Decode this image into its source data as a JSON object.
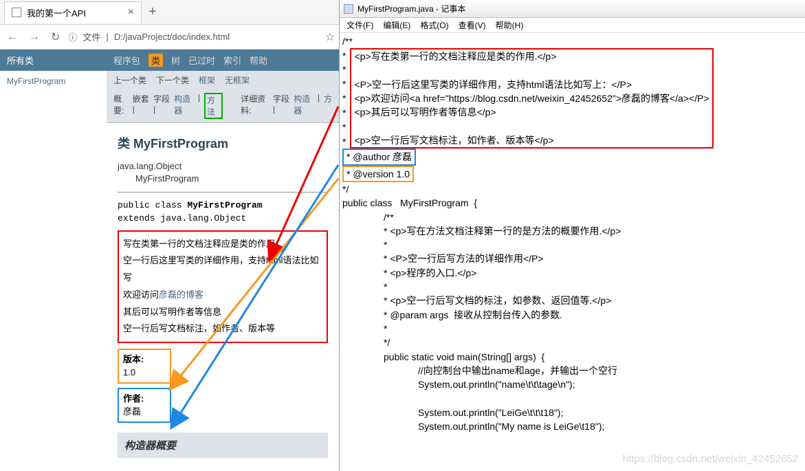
{
  "browser": {
    "tab_title": "我的第一个API",
    "url_label": "文件",
    "url": "D:/javaProject/doc/index.html"
  },
  "sidebar": {
    "header": "所有类",
    "link": "MyFirstProgram"
  },
  "nav1": {
    "pkg": "程序包",
    "cls": "类",
    "tree": "树",
    "dep": "已过时",
    "idx": "索引",
    "help": "帮助"
  },
  "nav2": {
    "prev": "上一个类",
    "next": "下一个类",
    "frames": "框架",
    "noframes": "无框架"
  },
  "nav3": {
    "summary": "概要:",
    "nest": "嵌套 |",
    "field": "字段 |",
    "ctor": "构造器",
    "meth": "方法",
    "detail": "详细资料:",
    "dfield": "字段 |",
    "dctor": "构造器",
    "dmeth": "方"
  },
  "cls": {
    "title": "类 MyFirstProgram",
    "super": "java.lang.Object",
    "self": "MyFirstProgram",
    "sig1": "public class ",
    "sig1b": "MyFirstProgram",
    "sig2": "extends java.lang.Object",
    "d1": "写在类第一行的文档注释应是类的作用.",
    "d2": "空一行后这里写类的详细作用，支持html语法比如写",
    "d3a": "欢迎访问",
    "d3b": "彦磊的博客",
    "d4": "其后可以写明作者等信息",
    "d5": "空一行后写文档标注，如作者、版本等",
    "ver_lbl": "版本:",
    "ver": "1.0",
    "auth_lbl": "作者:",
    "auth": "彦磊",
    "ctor": "构造器概要"
  },
  "notepad": {
    "title": "MyFirstProgram.java - 记事本",
    "menu": {
      "file": "文件(F)",
      "edit": "编辑(E)",
      "format": "格式(O)",
      "view": "查看(V)",
      "help": "帮助(H)"
    },
    "c0": "/**",
    "c_star": "*",
    "r1": "<p>写在类第一行的文档注释应是类的作用.</p>",
    "r2": "<P>空一行后这里写类的详细作用，支持html语法比如写上：</P>",
    "r3": "<p>欢迎访问<a href=\"https://blog.csdn.net/weixin_42452652\">彦磊的博客</a></P>",
    "r4": "<p>其后可以写明作者等信息</p>",
    "r5": "<p>空一行后写文档标注，如作者、版本等</p>",
    "author": "* @author 彦磊",
    "version": "* @version 1.0",
    "cend": "*/",
    "pclass": "public class   MyFirstProgram  {",
    "m0": "/**",
    "m1": "* <p>写在方法文档注释第一行的是方法的概要作用.</p>",
    "m2": "*",
    "m3": "* <P>空一行后写方法的详细作用</P>",
    "m4": "* <p>程序的入口.</p>",
    "m5": "*",
    "m6": "* <p>空一行后写文档的标注，如参数、返回值等.</p>",
    "m7": "* @param args  接收从控制台传入的参数.",
    "m8": "*",
    "m9": "*/",
    "main": "public static void main(String[] args)  {",
    "b1": "//向控制台中输出name和age，并输出一个空行",
    "b2": "System.out.println(\"name\\t\\t\\tage\\n\");",
    "b3": "System.out.println(\"LeiGe\\t\\t\\t18\");",
    "b4": "System.out.println(\"My name is LeiGe\\t18\");",
    "watermark": "https://blog.csdn.net/weixin_42452652"
  }
}
